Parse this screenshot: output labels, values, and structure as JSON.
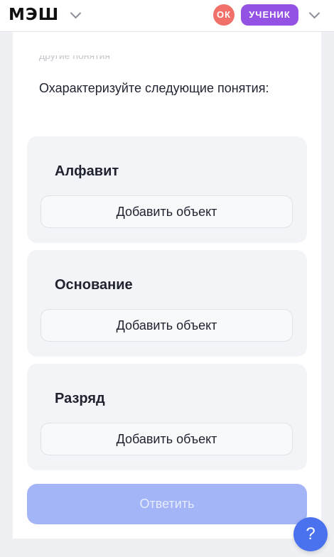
{
  "header": {
    "logo": "МЭШ",
    "badge": "ОК",
    "role": "УЧЕНИК",
    "colors": {
      "badge": "#f2706a",
      "role": "#9352e3"
    }
  },
  "task": {
    "cut_text": "другие понятия",
    "question": "Охарактеризуйте следующие понятия:",
    "groups": [
      {
        "title": "Алфавит",
        "add_label": "Добавить объект"
      },
      {
        "title": "Основание",
        "add_label": "Добавить объект"
      },
      {
        "title": "Разряд",
        "add_label": "Добавить объект"
      }
    ],
    "answer_label": "Ответить"
  },
  "help": {
    "label": "?"
  },
  "icons": [
    "chevron-down-icon",
    "help-icon"
  ]
}
